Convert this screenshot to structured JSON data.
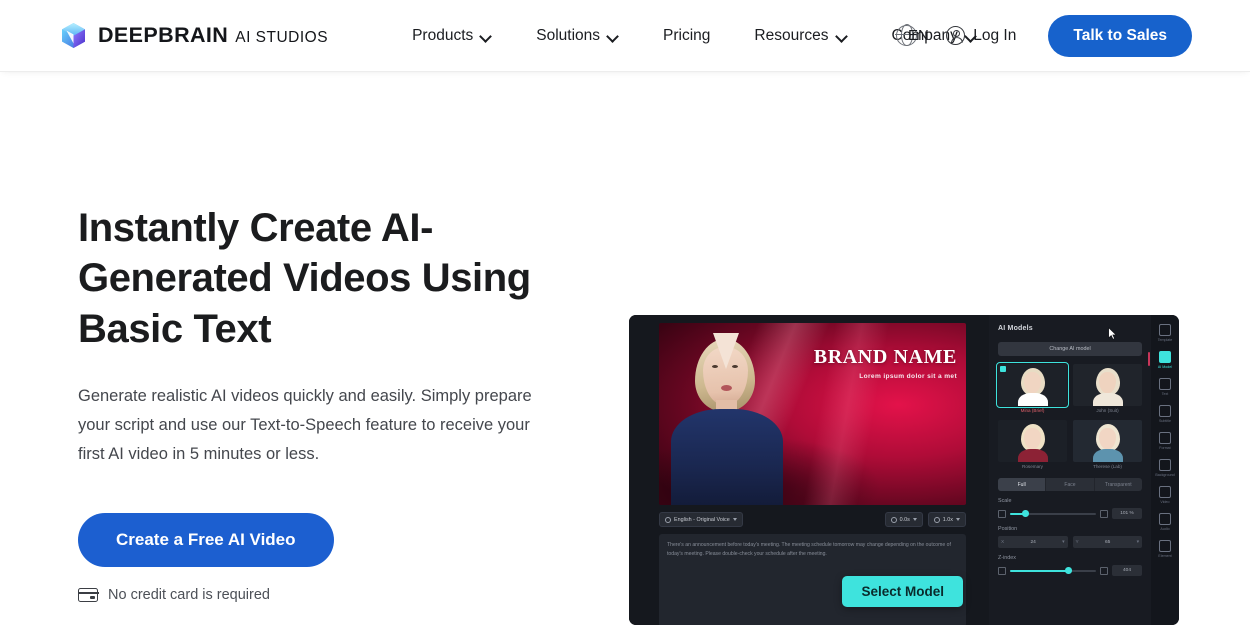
{
  "header": {
    "brand": {
      "name": "DEEPBRAIN",
      "sub": "AI STUDIOS",
      "logo_icon": "cube-logo-icon"
    },
    "nav": [
      {
        "label": "Products",
        "has_dropdown": true
      },
      {
        "label": "Solutions",
        "has_dropdown": true
      },
      {
        "label": "Pricing",
        "has_dropdown": false
      },
      {
        "label": "Resources",
        "has_dropdown": true
      },
      {
        "label": "Company",
        "has_dropdown": true
      }
    ],
    "language": {
      "code": "EN",
      "icon": "globe-icon"
    },
    "login": {
      "label": "Log In",
      "icon": "user-circle-icon"
    },
    "cta": {
      "label": "Talk to Sales",
      "color": "#1762cc"
    }
  },
  "hero": {
    "title": "Instantly Create AI-Generated Videos Using Basic Text",
    "subtitle": "Generate realistic AI videos quickly and easily. Simply prepare your script and use our Text-to-Speech feature to receive your first AI video in 5 minutes or less.",
    "cta": {
      "label": "Create a Free AI Video",
      "color": "#1c5fd0"
    },
    "note": {
      "label": "No credit card is required",
      "icon": "credit-card-icon"
    }
  },
  "app_preview": {
    "video": {
      "brand_title": "BRAND NAME",
      "brand_tagline": "Lorem ipsum dolor sit a met"
    },
    "toolbar": {
      "voice_chip": "English - Original Voice",
      "duration_chip": "0.0s",
      "speed_chip": "1.0x"
    },
    "script": "There's an announcement before today's meeting. The meeting schedule tomorrow may change depending on the outcome of today's meeting. Please double-check your schedule after the meeting.",
    "select_model_button": {
      "label": "Select Model",
      "color": "#3ee3dd"
    },
    "panel": {
      "title": "AI Models",
      "change_model_button": "Change AI model",
      "models": [
        {
          "name": "Mina (Brief)",
          "selected": true,
          "hair": "#e8dcc4",
          "skin": "#f0d5c2",
          "top": "#ffffff",
          "bg": "#1d2128"
        },
        {
          "name": "John (Suit)",
          "selected": false,
          "hair": "#e9dfcb",
          "skin": "#efd3bf",
          "top": "#efe7da",
          "bg": "#20242b"
        },
        {
          "name": "Rosemary",
          "selected": false,
          "hair": "#efe2c6",
          "skin": "#f2d6c3",
          "top": "#8c2235",
          "bg": "#1c2027"
        },
        {
          "name": "Therese (Lab)",
          "selected": false,
          "hair": "#efe6d2",
          "skin": "#f1d6c4",
          "top": "#5d93ae",
          "bg": "#232932"
        }
      ],
      "segments": [
        {
          "label": "Full",
          "active": true
        },
        {
          "label": "Face",
          "active": false
        },
        {
          "label": "Transparent",
          "active": false
        }
      ],
      "controls": [
        {
          "label": "Scale",
          "value": "101 %",
          "fill_pct": 18
        },
        {
          "label": "Position",
          "x": "24",
          "y": "65"
        },
        {
          "label": "Z-index",
          "value": "404",
          "fill_pct": 68
        }
      ]
    },
    "rail": [
      {
        "label": "Template",
        "icon": "template-icon",
        "active": false
      },
      {
        "label": "AI Model",
        "icon": "ai-model-icon",
        "active": true
      },
      {
        "label": "Text",
        "icon": "text-icon",
        "active": false
      },
      {
        "label": "Subtitle",
        "icon": "subtitle-icon",
        "active": false
      },
      {
        "label": "Format",
        "icon": "format-icon",
        "active": false
      },
      {
        "label": "Background",
        "icon": "background-icon",
        "active": false
      },
      {
        "label": "Video",
        "icon": "video-icon",
        "active": false
      },
      {
        "label": "Audio",
        "icon": "audio-icon",
        "active": false
      },
      {
        "label": "Element",
        "icon": "element-icon",
        "active": false
      }
    ],
    "cursor_icon": "mouse-pointer-icon"
  }
}
